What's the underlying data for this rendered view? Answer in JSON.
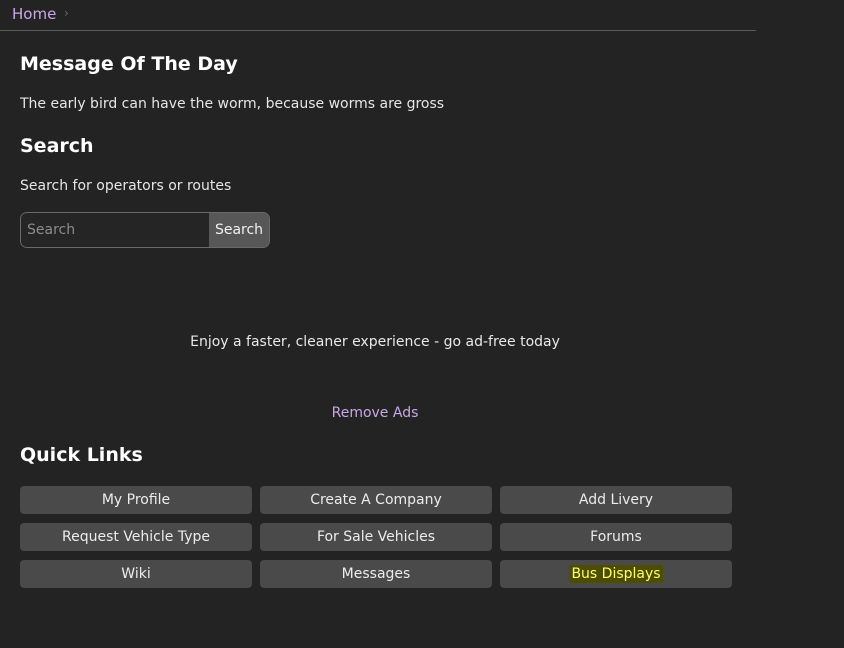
{
  "breadcrumb": {
    "home": "Home",
    "separator": "›"
  },
  "motd": {
    "heading": "Message Of The Day",
    "message": "The early bird can have the worm, because worms are gross"
  },
  "search": {
    "heading": "Search",
    "description": "Search for operators or routes",
    "placeholder": "Search",
    "button_label": "Search"
  },
  "promo": {
    "text": "Enjoy a faster, cleaner experience - go ad-free today",
    "remove_ads": "Remove Ads"
  },
  "quick_links": {
    "heading": "Quick Links",
    "items": [
      {
        "label": "My Profile"
      },
      {
        "label": "Create A Company"
      },
      {
        "label": "Add Livery"
      },
      {
        "label": "Request Vehicle Type"
      },
      {
        "label": "For Sale Vehicles"
      },
      {
        "label": "Forums"
      },
      {
        "label": "Wiki"
      },
      {
        "label": "Messages"
      },
      {
        "label": "Bus Displays"
      }
    ]
  },
  "colors": {
    "background": "#232323",
    "link": "#c9a8e8",
    "button": "#4a4a4a",
    "highlight_bg": "#4d4d00",
    "highlight_text": "#ffff66"
  }
}
